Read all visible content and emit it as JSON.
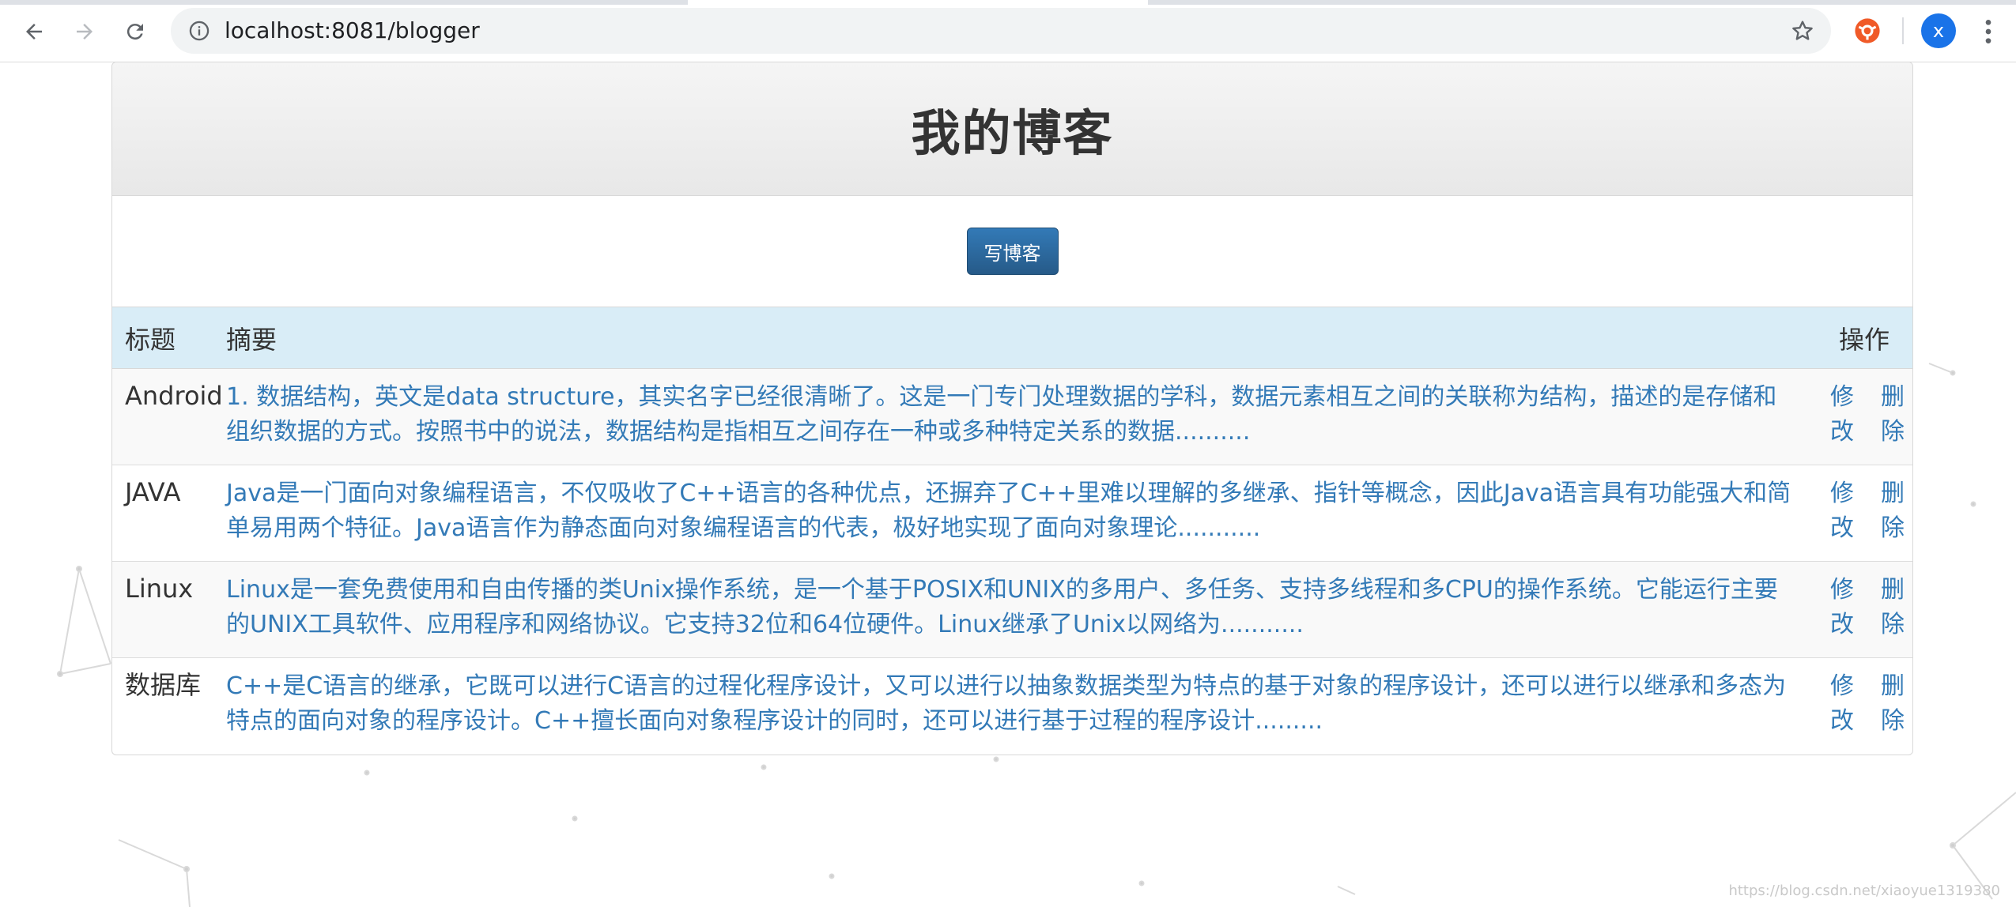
{
  "browser": {
    "url": "localhost:8081/blogger",
    "avatar_letter": "x"
  },
  "page": {
    "title": "我的博客",
    "write_button": "写博客"
  },
  "table": {
    "headers": {
      "title": "标题",
      "summary": "摘要",
      "ops": "操作"
    },
    "rows": [
      {
        "title": "Android",
        "summary": "1. 数据结构，英文是data structure，其实名字已经很清晰了。这是一门专门处理数据的学科，数据元素相互之间的关联称为结构，描述的是存储和组织数据的方式。按照书中的说法，数据结构是指相互之间存在一种或多种特定关系的数据..........",
        "edit": "修改",
        "delete": "删除"
      },
      {
        "title": "JAVA",
        "summary": "Java是一门面向对象编程语言，不仅吸收了C++语言的各种优点，还摒弃了C++里难以理解的多继承、指针等概念，因此Java语言具有功能强大和简单易用两个特征。Java语言作为静态面向对象编程语言的代表，极好地实现了面向对象理论...........",
        "edit": "修改",
        "delete": "删除"
      },
      {
        "title": "Linux",
        "summary": "Linux是一套免费使用和自由传播的类Unix操作系统，是一个基于POSIX和UNIX的多用户、多任务、支持多线程和多CPU的操作系统。它能运行主要的UNIX工具软件、应用程序和网络协议。它支持32位和64位硬件。Linux继承了Unix以网络为...........",
        "edit": "修改",
        "delete": "删除"
      },
      {
        "title": "数据库",
        "summary": "C++是C语言的继承，它既可以进行C语言的过程化程序设计，又可以进行以抽象数据类型为特点的基于对象的程序设计，还可以进行以继承和多态为特点的面向对象的程序设计。C++擅长面向对象程序设计的同时，还可以进行基于过程的程序设计.........",
        "edit": "修改",
        "delete": "删除"
      }
    ]
  },
  "watermark": "https://blog.csdn.net/xiaoyue1319380",
  "colors": {
    "link": "#337ab7",
    "header_row": "#d9edf7",
    "button": "#337ab7"
  }
}
